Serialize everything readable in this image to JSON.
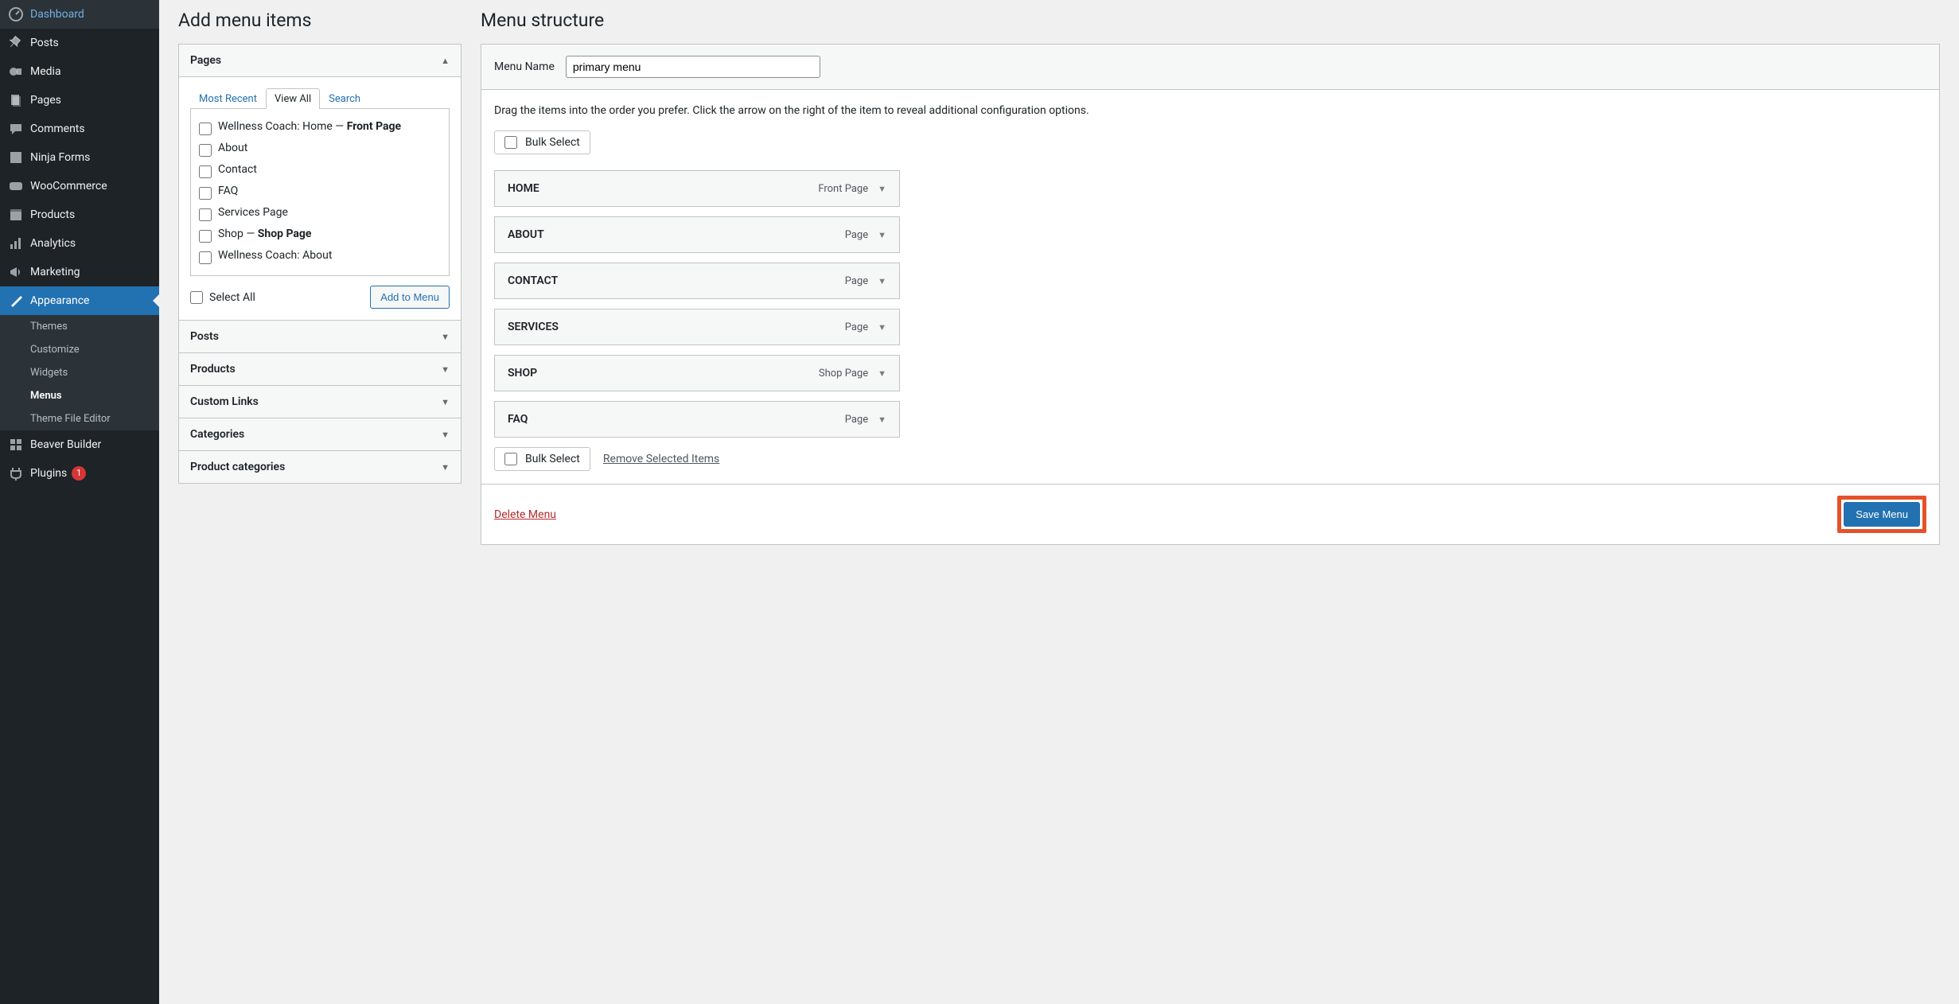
{
  "sidebar": {
    "items": [
      {
        "label": "Dashboard"
      },
      {
        "label": "Posts"
      },
      {
        "label": "Media"
      },
      {
        "label": "Pages"
      },
      {
        "label": "Comments"
      },
      {
        "label": "Ninja Forms"
      },
      {
        "label": "WooCommerce"
      },
      {
        "label": "Products"
      },
      {
        "label": "Analytics"
      },
      {
        "label": "Marketing"
      },
      {
        "label": "Appearance"
      },
      {
        "label": "Beaver Builder"
      },
      {
        "label": "Plugins"
      }
    ],
    "appearance_sub": [
      {
        "label": "Themes"
      },
      {
        "label": "Customize"
      },
      {
        "label": "Widgets"
      },
      {
        "label": "Menus"
      },
      {
        "label": "Theme File Editor"
      }
    ],
    "plugins_badge": "1"
  },
  "left": {
    "heading": "Add menu items",
    "pages_title": "Pages",
    "tabs": {
      "recent": "Most Recent",
      "all": "View All",
      "search": "Search"
    },
    "pages_list": [
      {
        "label_pre": "Wellness Coach: Home — ",
        "label_bold": "Front Page"
      },
      {
        "label_pre": "About",
        "label_bold": ""
      },
      {
        "label_pre": "Contact",
        "label_bold": ""
      },
      {
        "label_pre": "FAQ",
        "label_bold": ""
      },
      {
        "label_pre": "Services Page",
        "label_bold": ""
      },
      {
        "label_pre": "Shop — ",
        "label_bold": "Shop Page"
      },
      {
        "label_pre": "Wellness Coach: About",
        "label_bold": ""
      }
    ],
    "select_all": "Select All",
    "add_to_menu": "Add to Menu",
    "sections": [
      "Posts",
      "Products",
      "Custom Links",
      "Categories",
      "Product categories"
    ]
  },
  "right": {
    "heading": "Menu structure",
    "menu_name_label": "Menu Name",
    "menu_name_value": "primary menu",
    "hint": "Drag the items into the order you prefer. Click the arrow on the right of the item to reveal additional configuration options.",
    "bulk_select": "Bulk Select",
    "items": [
      {
        "title": "HOME",
        "type": "Front Page"
      },
      {
        "title": "ABOUT",
        "type": "Page"
      },
      {
        "title": "CONTACT",
        "type": "Page"
      },
      {
        "title": "SERVICES",
        "type": "Page"
      },
      {
        "title": "SHOP",
        "type": "Shop Page"
      },
      {
        "title": "FAQ",
        "type": "Page"
      }
    ],
    "remove_selected": "Remove Selected Items",
    "delete_menu": "Delete Menu",
    "save_menu": "Save Menu"
  }
}
